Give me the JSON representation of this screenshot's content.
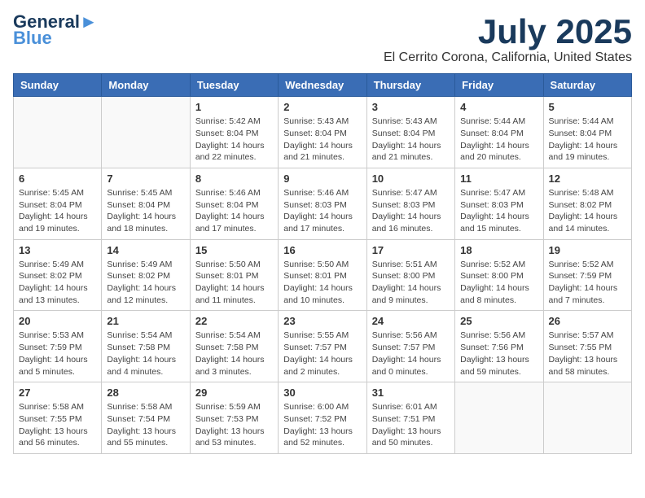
{
  "header": {
    "logo_line1": "General",
    "logo_line2": "Blue",
    "month_year": "July 2025",
    "location": "El Cerrito Corona, California, United States"
  },
  "weekdays": [
    "Sunday",
    "Monday",
    "Tuesday",
    "Wednesday",
    "Thursday",
    "Friday",
    "Saturday"
  ],
  "weeks": [
    [
      {
        "day": "",
        "info": ""
      },
      {
        "day": "",
        "info": ""
      },
      {
        "day": "1",
        "info": "Sunrise: 5:42 AM\nSunset: 8:04 PM\nDaylight: 14 hours and 22 minutes."
      },
      {
        "day": "2",
        "info": "Sunrise: 5:43 AM\nSunset: 8:04 PM\nDaylight: 14 hours and 21 minutes."
      },
      {
        "day": "3",
        "info": "Sunrise: 5:43 AM\nSunset: 8:04 PM\nDaylight: 14 hours and 21 minutes."
      },
      {
        "day": "4",
        "info": "Sunrise: 5:44 AM\nSunset: 8:04 PM\nDaylight: 14 hours and 20 minutes."
      },
      {
        "day": "5",
        "info": "Sunrise: 5:44 AM\nSunset: 8:04 PM\nDaylight: 14 hours and 19 minutes."
      }
    ],
    [
      {
        "day": "6",
        "info": "Sunrise: 5:45 AM\nSunset: 8:04 PM\nDaylight: 14 hours and 19 minutes."
      },
      {
        "day": "7",
        "info": "Sunrise: 5:45 AM\nSunset: 8:04 PM\nDaylight: 14 hours and 18 minutes."
      },
      {
        "day": "8",
        "info": "Sunrise: 5:46 AM\nSunset: 8:04 PM\nDaylight: 14 hours and 17 minutes."
      },
      {
        "day": "9",
        "info": "Sunrise: 5:46 AM\nSunset: 8:03 PM\nDaylight: 14 hours and 17 minutes."
      },
      {
        "day": "10",
        "info": "Sunrise: 5:47 AM\nSunset: 8:03 PM\nDaylight: 14 hours and 16 minutes."
      },
      {
        "day": "11",
        "info": "Sunrise: 5:47 AM\nSunset: 8:03 PM\nDaylight: 14 hours and 15 minutes."
      },
      {
        "day": "12",
        "info": "Sunrise: 5:48 AM\nSunset: 8:02 PM\nDaylight: 14 hours and 14 minutes."
      }
    ],
    [
      {
        "day": "13",
        "info": "Sunrise: 5:49 AM\nSunset: 8:02 PM\nDaylight: 14 hours and 13 minutes."
      },
      {
        "day": "14",
        "info": "Sunrise: 5:49 AM\nSunset: 8:02 PM\nDaylight: 14 hours and 12 minutes."
      },
      {
        "day": "15",
        "info": "Sunrise: 5:50 AM\nSunset: 8:01 PM\nDaylight: 14 hours and 11 minutes."
      },
      {
        "day": "16",
        "info": "Sunrise: 5:50 AM\nSunset: 8:01 PM\nDaylight: 14 hours and 10 minutes."
      },
      {
        "day": "17",
        "info": "Sunrise: 5:51 AM\nSunset: 8:00 PM\nDaylight: 14 hours and 9 minutes."
      },
      {
        "day": "18",
        "info": "Sunrise: 5:52 AM\nSunset: 8:00 PM\nDaylight: 14 hours and 8 minutes."
      },
      {
        "day": "19",
        "info": "Sunrise: 5:52 AM\nSunset: 7:59 PM\nDaylight: 14 hours and 7 minutes."
      }
    ],
    [
      {
        "day": "20",
        "info": "Sunrise: 5:53 AM\nSunset: 7:59 PM\nDaylight: 14 hours and 5 minutes."
      },
      {
        "day": "21",
        "info": "Sunrise: 5:54 AM\nSunset: 7:58 PM\nDaylight: 14 hours and 4 minutes."
      },
      {
        "day": "22",
        "info": "Sunrise: 5:54 AM\nSunset: 7:58 PM\nDaylight: 14 hours and 3 minutes."
      },
      {
        "day": "23",
        "info": "Sunrise: 5:55 AM\nSunset: 7:57 PM\nDaylight: 14 hours and 2 minutes."
      },
      {
        "day": "24",
        "info": "Sunrise: 5:56 AM\nSunset: 7:57 PM\nDaylight: 14 hours and 0 minutes."
      },
      {
        "day": "25",
        "info": "Sunrise: 5:56 AM\nSunset: 7:56 PM\nDaylight: 13 hours and 59 minutes."
      },
      {
        "day": "26",
        "info": "Sunrise: 5:57 AM\nSunset: 7:55 PM\nDaylight: 13 hours and 58 minutes."
      }
    ],
    [
      {
        "day": "27",
        "info": "Sunrise: 5:58 AM\nSunset: 7:55 PM\nDaylight: 13 hours and 56 minutes."
      },
      {
        "day": "28",
        "info": "Sunrise: 5:58 AM\nSunset: 7:54 PM\nDaylight: 13 hours and 55 minutes."
      },
      {
        "day": "29",
        "info": "Sunrise: 5:59 AM\nSunset: 7:53 PM\nDaylight: 13 hours and 53 minutes."
      },
      {
        "day": "30",
        "info": "Sunrise: 6:00 AM\nSunset: 7:52 PM\nDaylight: 13 hours and 52 minutes."
      },
      {
        "day": "31",
        "info": "Sunrise: 6:01 AM\nSunset: 7:51 PM\nDaylight: 13 hours and 50 minutes."
      },
      {
        "day": "",
        "info": ""
      },
      {
        "day": "",
        "info": ""
      }
    ]
  ]
}
